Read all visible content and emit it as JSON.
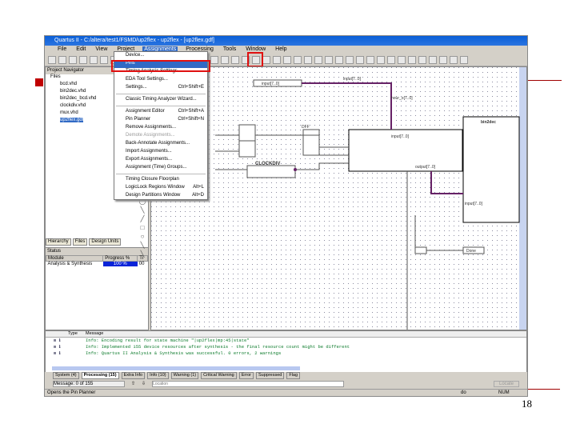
{
  "window": {
    "title": "Quartus II - C:/altera/test1/FSMD/up2flex - up2flex - [up2flex.gdf]"
  },
  "menubar": [
    "File",
    "Edit",
    "View",
    "Project",
    "Assignments",
    "Processing",
    "Tools",
    "Window",
    "Help"
  ],
  "assignments_menu": {
    "items": [
      {
        "label": "Device...",
        "shortcut": ""
      },
      {
        "label": "Pins",
        "shortcut": "",
        "highlighted": true
      },
      {
        "label": "Timing Analysis Settings...",
        "shortcut": ""
      },
      {
        "label": "EDA Tool Settings...",
        "shortcut": ""
      },
      {
        "label": "Settings...",
        "shortcut": "Ctrl+Shift+E"
      },
      {
        "label": "Classic Timing Analyzer Wizard...",
        "shortcut": "",
        "sep_before": true
      },
      {
        "label": "Assignment Editor",
        "shortcut": "Ctrl+Shift+A",
        "sep_before": true
      },
      {
        "label": "Pin Planner",
        "shortcut": "Ctrl+Shift+N"
      },
      {
        "label": "Remove Assignments...",
        "shortcut": ""
      },
      {
        "label": "Demote Assignments...",
        "shortcut": "",
        "disabled": true
      },
      {
        "label": "Back-Annotate Assignments...",
        "shortcut": ""
      },
      {
        "label": "Import Assignments...",
        "shortcut": ""
      },
      {
        "label": "Export Assignments...",
        "shortcut": ""
      },
      {
        "label": "Assignment (Time) Groups...",
        "shortcut": ""
      },
      {
        "label": "Timing Closure Floorplan",
        "shortcut": "",
        "sep_before": true
      },
      {
        "label": "LogicLock Regions Window",
        "shortcut": "Alt+L"
      },
      {
        "label": "Design Partitions Window",
        "shortcut": "Alt+D"
      }
    ]
  },
  "navigator": {
    "title": "Project Navigator",
    "root": "Files",
    "files": [
      "bcd.vhd",
      "bin2dec.vhd",
      "bin2dec_bcd.vhd",
      "clockdiv.vhd",
      "mux.vhd",
      "up2flex.gdf"
    ],
    "selected": "up2flex.gdf",
    "tabs": [
      "Hierarchy",
      "Files",
      "Design Units"
    ]
  },
  "status": {
    "title": "Status",
    "columns": [
      "Module",
      "Progress %",
      "Ti"
    ],
    "rows": [
      [
        "Analysis & Synthesis",
        "100 %",
        "00"
      ]
    ]
  },
  "schematic": {
    "labels": [
      "input[7..0]",
      "input[7..0]",
      "hour_o[7..0]",
      "CLOCKDIV",
      "DFF",
      "input[7..0]",
      "output[7..0]",
      "bin2dec",
      "input[7..0]",
      "Done"
    ]
  },
  "messages": {
    "columns": [
      "Type",
      "Message"
    ],
    "rows": [
      "Info: Encoding result for state machine \"|up2flex|mp:45|state\"",
      "Info: Implemented 155 device resources after synthesis - the final resource count might be different",
      "Info: Quartus II Analysis & Synthesis was successful. 0 errors, 2 warnings"
    ],
    "tabs": [
      "System (4)",
      "Processing (15)",
      "Extra Info",
      "Info (10)",
      "Warning (1)",
      "Critical Warning",
      "Error",
      "Suppressed",
      "Flag"
    ],
    "active_tab": "Processing (15)",
    "counter": "Message: 0 of 155",
    "location_placeholder": "Location",
    "locate_button": "Locate"
  },
  "statusbar": {
    "text": "Opens the Pin Planner",
    "field1": "do",
    "field2": "NUM"
  },
  "slide": {
    "page_number": "18",
    "accent": "#c00000"
  }
}
